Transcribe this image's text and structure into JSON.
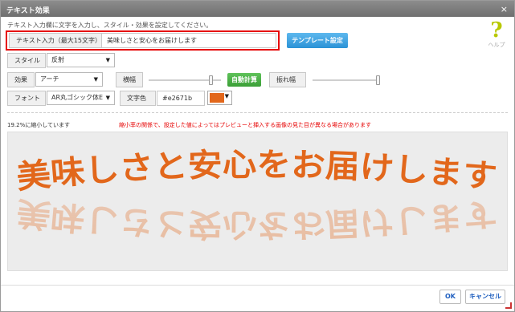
{
  "dialog": {
    "title": "テキスト効果",
    "close": "×",
    "instruction": "テキスト入力欄に文字を入力し、スタイル・効果を設定してください。",
    "help_label": "ヘルプ"
  },
  "text_input": {
    "label": "テキスト入力（最大15文字）",
    "value": "美味しさと安心をお届けします"
  },
  "template_button": "テンプレート設定",
  "style": {
    "label": "スタイル",
    "selected": "反射"
  },
  "effect": {
    "label": "効果",
    "selected": "アーチ"
  },
  "width": {
    "label": "横幅",
    "slider_value": 0.88
  },
  "auto_calc_button": "自動計算",
  "amplitude": {
    "label": "振れ幅",
    "slider_value": 1.0
  },
  "font": {
    "label": "フォント",
    "selected": "AR丸ゴシック体E"
  },
  "text_color": {
    "label": "文字色",
    "value": "#e2671b",
    "color": "#e2671b"
  },
  "preview": {
    "scale_note": "19.2%に縮小しています",
    "warning": "縮小率の関係で、設定した値によってはプレビューと挿入する画像の見た目が異なる場合があります",
    "text": "美味しさと安心をお届けします"
  },
  "footer": {
    "ok": "OK",
    "cancel": "キャンセル"
  }
}
